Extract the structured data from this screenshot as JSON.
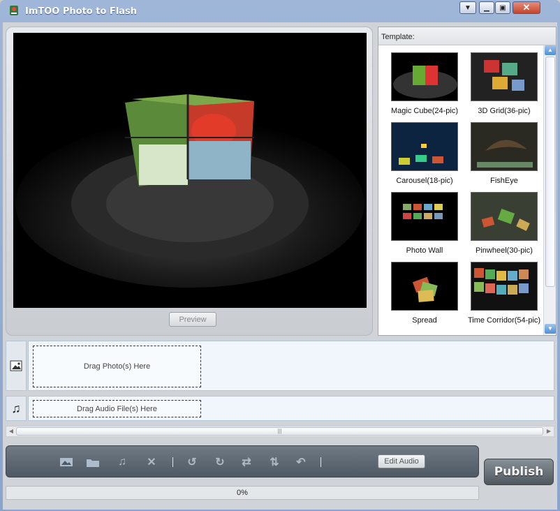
{
  "window": {
    "title": "ImTOO Photo to Flash"
  },
  "preview": {
    "button_label": "Preview"
  },
  "templates": {
    "header": "Template:",
    "items": [
      {
        "label": "Magic Cube(24-pic)"
      },
      {
        "label": "3D Grid(36-pic)"
      },
      {
        "label": "Carousel(18-pic)"
      },
      {
        "label": "FishEye"
      },
      {
        "label": "Photo Wall"
      },
      {
        "label": "Pinwheel(30-pic)"
      },
      {
        "label": "Spread"
      },
      {
        "label": "Time Corridor(54-pic)"
      }
    ]
  },
  "photo_track": {
    "drop_label": "Drag Photo(s) Here",
    "icon": "image-icon"
  },
  "audio_track": {
    "drop_label": "Drag Audio File(s) Here",
    "icon": "music-note-icon"
  },
  "toolbar": {
    "tools": [
      "add-photo-icon",
      "add-folder-icon",
      "add-audio-icon",
      "delete-icon",
      "rotate-left-icon",
      "rotate-right-icon",
      "swap-icon",
      "sort-icon",
      "undo-icon"
    ],
    "edit_audio_label": "Edit Audio"
  },
  "publish_label": "Publish",
  "progress": {
    "text": "0%",
    "value": 0
  }
}
